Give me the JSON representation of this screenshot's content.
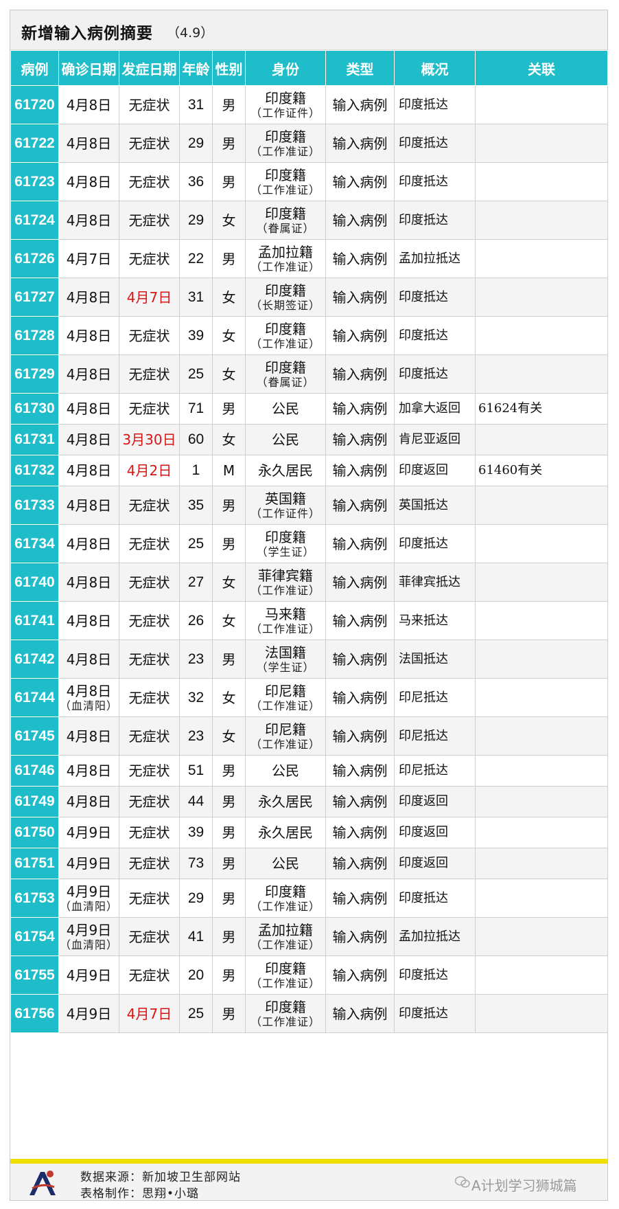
{
  "title": {
    "main": "新增输入病例摘要",
    "date": "（4.9）"
  },
  "headers": [
    "病例",
    "确诊日期",
    "发症日期",
    "年龄",
    "性别",
    "身份",
    "类型",
    "概况",
    "关联"
  ],
  "rows": [
    {
      "id": "61720",
      "confirm": "4月8日",
      "confirm_note": "",
      "onset": "无症状",
      "onset_red": false,
      "age": "31",
      "sex": "男",
      "identity": "印度籍",
      "identity_note": "（工作证件）",
      "type": "输入病例",
      "summary": "印度抵达",
      "link": ""
    },
    {
      "id": "61722",
      "confirm": "4月8日",
      "confirm_note": "",
      "onset": "无症状",
      "onset_red": false,
      "age": "29",
      "sex": "男",
      "identity": "印度籍",
      "identity_note": "（工作准证）",
      "type": "输入病例",
      "summary": "印度抵达",
      "link": ""
    },
    {
      "id": "61723",
      "confirm": "4月8日",
      "confirm_note": "",
      "onset": "无症状",
      "onset_red": false,
      "age": "36",
      "sex": "男",
      "identity": "印度籍",
      "identity_note": "（工作准证）",
      "type": "输入病例",
      "summary": "印度抵达",
      "link": ""
    },
    {
      "id": "61724",
      "confirm": "4月8日",
      "confirm_note": "",
      "onset": "无症状",
      "onset_red": false,
      "age": "29",
      "sex": "女",
      "identity": "印度籍",
      "identity_note": "（眷属证）",
      "type": "输入病例",
      "summary": "印度抵达",
      "link": ""
    },
    {
      "id": "61726",
      "confirm": "4月7日",
      "confirm_note": "",
      "onset": "无症状",
      "onset_red": false,
      "age": "22",
      "sex": "男",
      "identity": "孟加拉籍",
      "identity_note": "（工作准证）",
      "type": "输入病例",
      "summary": "孟加拉抵达",
      "link": ""
    },
    {
      "id": "61727",
      "confirm": "4月8日",
      "confirm_note": "",
      "onset": "4月7日",
      "onset_red": true,
      "age": "31",
      "sex": "女",
      "identity": "印度籍",
      "identity_note": "（长期签证）",
      "type": "输入病例",
      "summary": "印度抵达",
      "link": ""
    },
    {
      "id": "61728",
      "confirm": "4月8日",
      "confirm_note": "",
      "onset": "无症状",
      "onset_red": false,
      "age": "39",
      "sex": "女",
      "identity": "印度籍",
      "identity_note": "（工作准证）",
      "type": "输入病例",
      "summary": "印度抵达",
      "link": ""
    },
    {
      "id": "61729",
      "confirm": "4月8日",
      "confirm_note": "",
      "onset": "无症状",
      "onset_red": false,
      "age": "25",
      "sex": "女",
      "identity": "印度籍",
      "identity_note": "（眷属证）",
      "type": "输入病例",
      "summary": "印度抵达",
      "link": ""
    },
    {
      "id": "61730",
      "confirm": "4月8日",
      "confirm_note": "",
      "onset": "无症状",
      "onset_red": false,
      "age": "71",
      "sex": "男",
      "identity": "公民",
      "identity_note": "",
      "type": "输入病例",
      "summary": "加拿大返回",
      "link": "61624有关"
    },
    {
      "id": "61731",
      "confirm": "4月8日",
      "confirm_note": "",
      "onset": "3月30日",
      "onset_red": true,
      "age": "60",
      "sex": "女",
      "identity": "公民",
      "identity_note": "",
      "type": "输入病例",
      "summary": "肯尼亚返回",
      "link": ""
    },
    {
      "id": "61732",
      "confirm": "4月8日",
      "confirm_note": "",
      "onset": "4月2日",
      "onset_red": true,
      "age": "1",
      "sex": "M",
      "identity": "永久居民",
      "identity_note": "",
      "type": "输入病例",
      "summary": "印度返回",
      "link": "61460有关"
    },
    {
      "id": "61733",
      "confirm": "4月8日",
      "confirm_note": "",
      "onset": "无症状",
      "onset_red": false,
      "age": "35",
      "sex": "男",
      "identity": "英国籍",
      "identity_note": "（工作证件）",
      "type": "输入病例",
      "summary": "英国抵达",
      "link": ""
    },
    {
      "id": "61734",
      "confirm": "4月8日",
      "confirm_note": "",
      "onset": "无症状",
      "onset_red": false,
      "age": "25",
      "sex": "男",
      "identity": "印度籍",
      "identity_note": "（学生证）",
      "type": "输入病例",
      "summary": "印度抵达",
      "link": ""
    },
    {
      "id": "61740",
      "confirm": "4月8日",
      "confirm_note": "",
      "onset": "无症状",
      "onset_red": false,
      "age": "27",
      "sex": "女",
      "identity": "菲律宾籍",
      "identity_note": "（工作准证）",
      "type": "输入病例",
      "summary": "菲律宾抵达",
      "link": ""
    },
    {
      "id": "61741",
      "confirm": "4月8日",
      "confirm_note": "",
      "onset": "无症状",
      "onset_red": false,
      "age": "26",
      "sex": "女",
      "identity": "马来籍",
      "identity_note": "（工作准证）",
      "type": "输入病例",
      "summary": "马来抵达",
      "link": ""
    },
    {
      "id": "61742",
      "confirm": "4月8日",
      "confirm_note": "",
      "onset": "无症状",
      "onset_red": false,
      "age": "23",
      "sex": "男",
      "identity": "法国籍",
      "identity_note": "（学生证）",
      "type": "输入病例",
      "summary": "法国抵达",
      "link": ""
    },
    {
      "id": "61744",
      "confirm": "4月8日",
      "confirm_note": "（血清阳）",
      "onset": "无症状",
      "onset_red": false,
      "age": "32",
      "sex": "女",
      "identity": "印尼籍",
      "identity_note": "（工作准证）",
      "type": "输入病例",
      "summary": "印尼抵达",
      "link": ""
    },
    {
      "id": "61745",
      "confirm": "4月8日",
      "confirm_note": "",
      "onset": "无症状",
      "onset_red": false,
      "age": "23",
      "sex": "女",
      "identity": "印尼籍",
      "identity_note": "（工作准证）",
      "type": "输入病例",
      "summary": "印尼抵达",
      "link": ""
    },
    {
      "id": "61746",
      "confirm": "4月8日",
      "confirm_note": "",
      "onset": "无症状",
      "onset_red": false,
      "age": "51",
      "sex": "男",
      "identity": "公民",
      "identity_note": "",
      "type": "输入病例",
      "summary": "印尼抵达",
      "link": ""
    },
    {
      "id": "61749",
      "confirm": "4月8日",
      "confirm_note": "",
      "onset": "无症状",
      "onset_red": false,
      "age": "44",
      "sex": "男",
      "identity": "永久居民",
      "identity_note": "",
      "type": "输入病例",
      "summary": "印度返回",
      "link": ""
    },
    {
      "id": "61750",
      "confirm": "4月9日",
      "confirm_note": "",
      "onset": "无症状",
      "onset_red": false,
      "age": "39",
      "sex": "男",
      "identity": "永久居民",
      "identity_note": "",
      "type": "输入病例",
      "summary": "印度返回",
      "link": ""
    },
    {
      "id": "61751",
      "confirm": "4月9日",
      "confirm_note": "",
      "onset": "无症状",
      "onset_red": false,
      "age": "73",
      "sex": "男",
      "identity": "公民",
      "identity_note": "",
      "type": "输入病例",
      "summary": "印度返回",
      "link": ""
    },
    {
      "id": "61753",
      "confirm": "4月9日",
      "confirm_note": "（血清阳）",
      "onset": "无症状",
      "onset_red": false,
      "age": "29",
      "sex": "男",
      "identity": "印度籍",
      "identity_note": "（工作准证）",
      "type": "输入病例",
      "summary": "印度抵达",
      "link": ""
    },
    {
      "id": "61754",
      "confirm": "4月9日",
      "confirm_note": "（血清阳）",
      "onset": "无症状",
      "onset_red": false,
      "age": "41",
      "sex": "男",
      "identity": "孟加拉籍",
      "identity_note": "（工作准证）",
      "type": "输入病例",
      "summary": "孟加拉抵达",
      "link": ""
    },
    {
      "id": "61755",
      "confirm": "4月9日",
      "confirm_note": "",
      "onset": "无症状",
      "onset_red": false,
      "age": "20",
      "sex": "男",
      "identity": "印度籍",
      "identity_note": "（工作准证）",
      "type": "输入病例",
      "summary": "印度抵达",
      "link": ""
    },
    {
      "id": "61756",
      "confirm": "4月9日",
      "confirm_note": "",
      "onset": "4月7日",
      "onset_red": true,
      "age": "25",
      "sex": "男",
      "identity": "印度籍",
      "identity_note": "（工作准证）",
      "type": "输入病例",
      "summary": "印度抵达",
      "link": ""
    }
  ],
  "footer": {
    "source": "数据来源：新加坡卫生部网站",
    "maker": "表格制作：思翔•小璐",
    "watermark": "A计划学习狮城篇"
  },
  "colors": {
    "header": "#1ebdc9",
    "red": "#d81414",
    "accent_bar": "#f0e000"
  }
}
